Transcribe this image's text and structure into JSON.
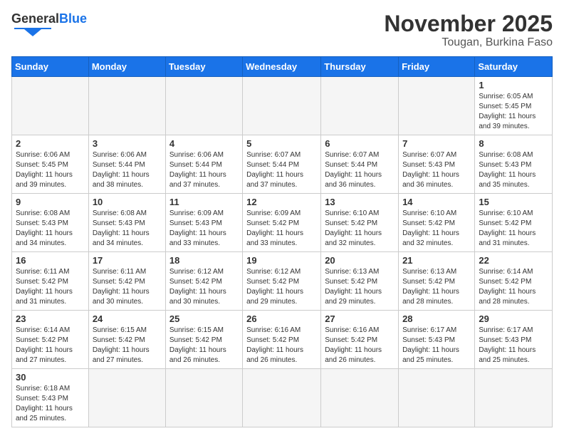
{
  "logo": {
    "text_general": "General",
    "text_blue": "Blue"
  },
  "title": "November 2025",
  "subtitle": "Tougan, Burkina Faso",
  "weekdays": [
    "Sunday",
    "Monday",
    "Tuesday",
    "Wednesday",
    "Thursday",
    "Friday",
    "Saturday"
  ],
  "weeks": [
    [
      {
        "day": "",
        "empty": true
      },
      {
        "day": "",
        "empty": true
      },
      {
        "day": "",
        "empty": true
      },
      {
        "day": "",
        "empty": true
      },
      {
        "day": "",
        "empty": true
      },
      {
        "day": "",
        "empty": true
      },
      {
        "day": "1",
        "sunrise": "Sunrise: 6:05 AM",
        "sunset": "Sunset: 5:45 PM",
        "daylight": "Daylight: 11 hours and 39 minutes."
      }
    ],
    [
      {
        "day": "2",
        "sunrise": "Sunrise: 6:06 AM",
        "sunset": "Sunset: 5:45 PM",
        "daylight": "Daylight: 11 hours and 39 minutes."
      },
      {
        "day": "3",
        "sunrise": "Sunrise: 6:06 AM",
        "sunset": "Sunset: 5:44 PM",
        "daylight": "Daylight: 11 hours and 38 minutes."
      },
      {
        "day": "4",
        "sunrise": "Sunrise: 6:06 AM",
        "sunset": "Sunset: 5:44 PM",
        "daylight": "Daylight: 11 hours and 37 minutes."
      },
      {
        "day": "5",
        "sunrise": "Sunrise: 6:07 AM",
        "sunset": "Sunset: 5:44 PM",
        "daylight": "Daylight: 11 hours and 37 minutes."
      },
      {
        "day": "6",
        "sunrise": "Sunrise: 6:07 AM",
        "sunset": "Sunset: 5:44 PM",
        "daylight": "Daylight: 11 hours and 36 minutes."
      },
      {
        "day": "7",
        "sunrise": "Sunrise: 6:07 AM",
        "sunset": "Sunset: 5:43 PM",
        "daylight": "Daylight: 11 hours and 36 minutes."
      },
      {
        "day": "8",
        "sunrise": "Sunrise: 6:08 AM",
        "sunset": "Sunset: 5:43 PM",
        "daylight": "Daylight: 11 hours and 35 minutes."
      }
    ],
    [
      {
        "day": "9",
        "sunrise": "Sunrise: 6:08 AM",
        "sunset": "Sunset: 5:43 PM",
        "daylight": "Daylight: 11 hours and 34 minutes."
      },
      {
        "day": "10",
        "sunrise": "Sunrise: 6:08 AM",
        "sunset": "Sunset: 5:43 PM",
        "daylight": "Daylight: 11 hours and 34 minutes."
      },
      {
        "day": "11",
        "sunrise": "Sunrise: 6:09 AM",
        "sunset": "Sunset: 5:43 PM",
        "daylight": "Daylight: 11 hours and 33 minutes."
      },
      {
        "day": "12",
        "sunrise": "Sunrise: 6:09 AM",
        "sunset": "Sunset: 5:42 PM",
        "daylight": "Daylight: 11 hours and 33 minutes."
      },
      {
        "day": "13",
        "sunrise": "Sunrise: 6:10 AM",
        "sunset": "Sunset: 5:42 PM",
        "daylight": "Daylight: 11 hours and 32 minutes."
      },
      {
        "day": "14",
        "sunrise": "Sunrise: 6:10 AM",
        "sunset": "Sunset: 5:42 PM",
        "daylight": "Daylight: 11 hours and 32 minutes."
      },
      {
        "day": "15",
        "sunrise": "Sunrise: 6:10 AM",
        "sunset": "Sunset: 5:42 PM",
        "daylight": "Daylight: 11 hours and 31 minutes."
      }
    ],
    [
      {
        "day": "16",
        "sunrise": "Sunrise: 6:11 AM",
        "sunset": "Sunset: 5:42 PM",
        "daylight": "Daylight: 11 hours and 31 minutes."
      },
      {
        "day": "17",
        "sunrise": "Sunrise: 6:11 AM",
        "sunset": "Sunset: 5:42 PM",
        "daylight": "Daylight: 11 hours and 30 minutes."
      },
      {
        "day": "18",
        "sunrise": "Sunrise: 6:12 AM",
        "sunset": "Sunset: 5:42 PM",
        "daylight": "Daylight: 11 hours and 30 minutes."
      },
      {
        "day": "19",
        "sunrise": "Sunrise: 6:12 AM",
        "sunset": "Sunset: 5:42 PM",
        "daylight": "Daylight: 11 hours and 29 minutes."
      },
      {
        "day": "20",
        "sunrise": "Sunrise: 6:13 AM",
        "sunset": "Sunset: 5:42 PM",
        "daylight": "Daylight: 11 hours and 29 minutes."
      },
      {
        "day": "21",
        "sunrise": "Sunrise: 6:13 AM",
        "sunset": "Sunset: 5:42 PM",
        "daylight": "Daylight: 11 hours and 28 minutes."
      },
      {
        "day": "22",
        "sunrise": "Sunrise: 6:14 AM",
        "sunset": "Sunset: 5:42 PM",
        "daylight": "Daylight: 11 hours and 28 minutes."
      }
    ],
    [
      {
        "day": "23",
        "sunrise": "Sunrise: 6:14 AM",
        "sunset": "Sunset: 5:42 PM",
        "daylight": "Daylight: 11 hours and 27 minutes."
      },
      {
        "day": "24",
        "sunrise": "Sunrise: 6:15 AM",
        "sunset": "Sunset: 5:42 PM",
        "daylight": "Daylight: 11 hours and 27 minutes."
      },
      {
        "day": "25",
        "sunrise": "Sunrise: 6:15 AM",
        "sunset": "Sunset: 5:42 PM",
        "daylight": "Daylight: 11 hours and 26 minutes."
      },
      {
        "day": "26",
        "sunrise": "Sunrise: 6:16 AM",
        "sunset": "Sunset: 5:42 PM",
        "daylight": "Daylight: 11 hours and 26 minutes."
      },
      {
        "day": "27",
        "sunrise": "Sunrise: 6:16 AM",
        "sunset": "Sunset: 5:42 PM",
        "daylight": "Daylight: 11 hours and 26 minutes."
      },
      {
        "day": "28",
        "sunrise": "Sunrise: 6:17 AM",
        "sunset": "Sunset: 5:43 PM",
        "daylight": "Daylight: 11 hours and 25 minutes."
      },
      {
        "day": "29",
        "sunrise": "Sunrise: 6:17 AM",
        "sunset": "Sunset: 5:43 PM",
        "daylight": "Daylight: 11 hours and 25 minutes."
      }
    ],
    [
      {
        "day": "30",
        "sunrise": "Sunrise: 6:18 AM",
        "sunset": "Sunset: 5:43 PM",
        "daylight": "Daylight: 11 hours and 25 minutes."
      },
      {
        "day": "",
        "empty": true
      },
      {
        "day": "",
        "empty": true
      },
      {
        "day": "",
        "empty": true
      },
      {
        "day": "",
        "empty": true
      },
      {
        "day": "",
        "empty": true
      },
      {
        "day": "",
        "empty": true
      }
    ]
  ]
}
